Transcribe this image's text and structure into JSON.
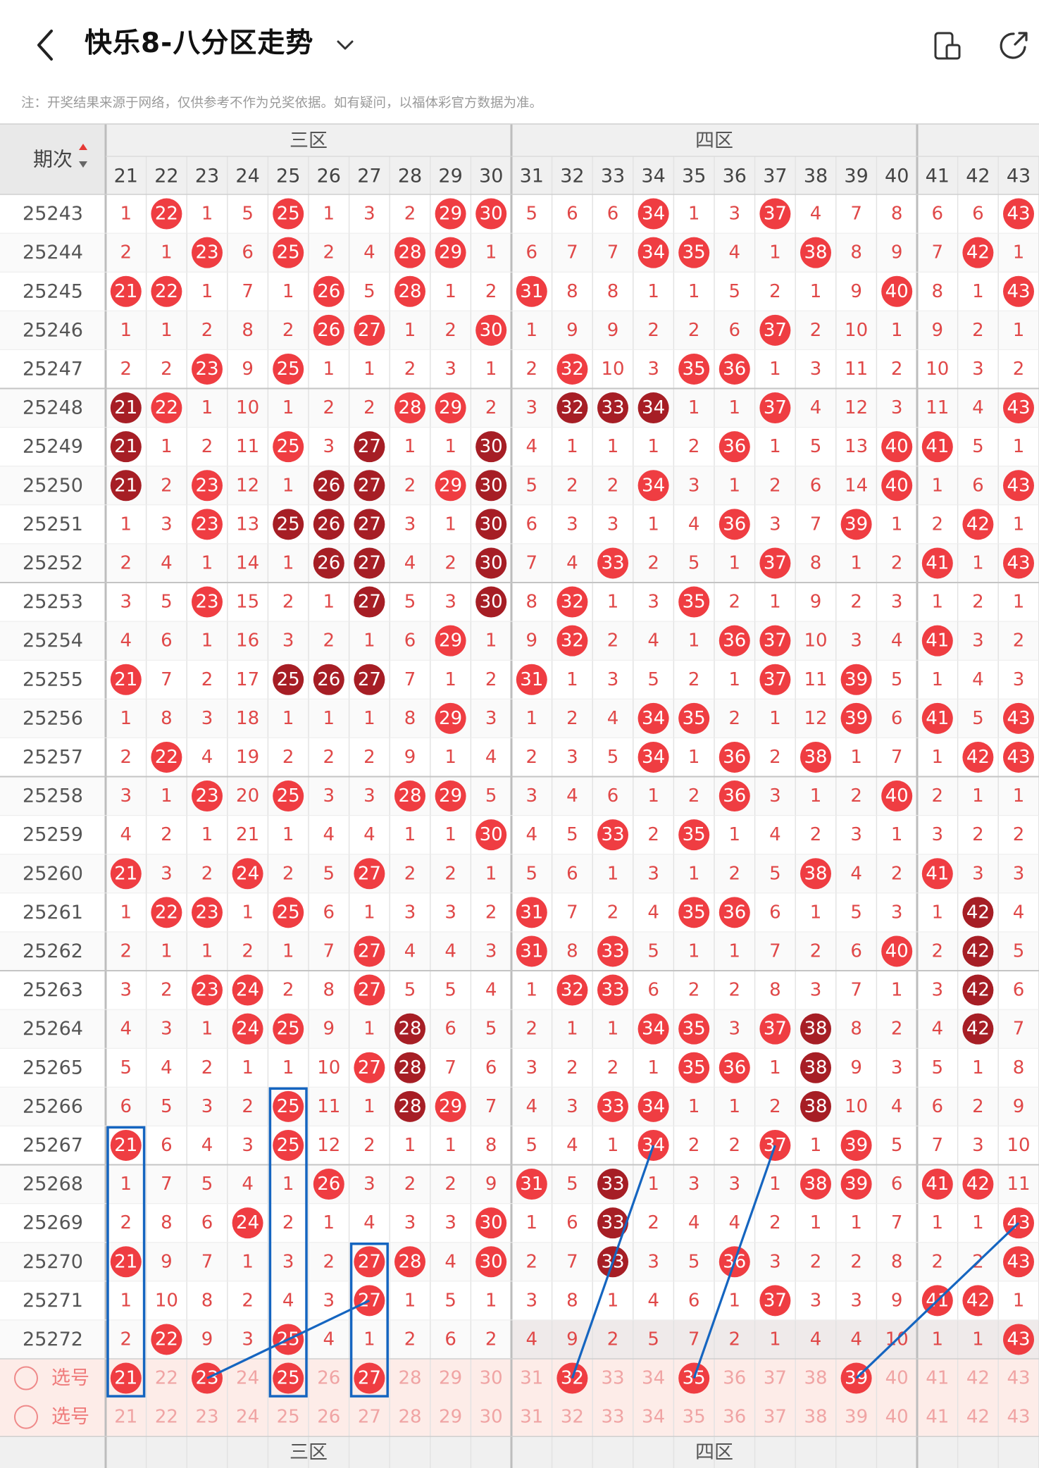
{
  "header": {
    "back_icon": "chevron-left-icon",
    "title": "快乐8-八分区走势",
    "dropdown_icon": "chevron-down-icon",
    "share_icon": "phone-split-icon",
    "refresh_icon": "share-external-icon",
    "note": "注：开奖结果来源于网络，仅供参考不作为兑奖依据。如有疑问，以福体彩官方数据为准。"
  },
  "table": {
    "period_header": "期次",
    "zones": [
      "三区",
      "四区"
    ],
    "columns": [
      21,
      22,
      23,
      24,
      25,
      26,
      27,
      28,
      29,
      30,
      31,
      32,
      33,
      34,
      35,
      36,
      37,
      38,
      39,
      40,
      41,
      42,
      43
    ],
    "rows": [
      {
        "period": "25243",
        "cells": [
          "1",
          "22",
          "1",
          "5",
          "25",
          "1",
          "3",
          "2",
          "29",
          "30",
          "5",
          "6",
          "6",
          "34",
          "1",
          "3",
          "37",
          "4",
          "7",
          "8",
          "6",
          "6",
          "43"
        ]
      },
      {
        "period": "25244",
        "cells": [
          "2",
          "1",
          "23",
          "6",
          "25",
          "2",
          "4",
          "28",
          "29",
          "1",
          "6",
          "7",
          "7",
          "34",
          "35",
          "4",
          "1",
          "38",
          "8",
          "9",
          "7",
          "42",
          "1"
        ]
      },
      {
        "period": "25245",
        "cells": [
          "21",
          "22",
          "1",
          "7",
          "1",
          "26",
          "5",
          "28",
          "1",
          "2",
          "31",
          "8",
          "8",
          "1",
          "1",
          "5",
          "2",
          "1",
          "9",
          "40",
          "8",
          "1",
          "43"
        ]
      },
      {
        "period": "25246",
        "cells": [
          "1",
          "1",
          "2",
          "8",
          "2",
          "26",
          "27",
          "1",
          "2",
          "30",
          "1",
          "9",
          "9",
          "2",
          "2",
          "6",
          "37",
          "2",
          "10",
          "1",
          "9",
          "2",
          "1"
        ]
      },
      {
        "period": "25247",
        "cells": [
          "2",
          "2",
          "23",
          "9",
          "25",
          "1",
          "1",
          "2",
          "3",
          "1",
          "2",
          "32",
          "10",
          "3",
          "35",
          "36",
          "1",
          "3",
          "11",
          "2",
          "10",
          "3",
          "2"
        ]
      },
      {
        "period": "25248",
        "cells": [
          "21",
          "22",
          "1",
          "10",
          "1",
          "2",
          "2",
          "28",
          "29",
          "2",
          "3",
          "32",
          "33",
          "34",
          "1",
          "1",
          "37",
          "4",
          "12",
          "3",
          "11",
          "4",
          "43"
        ]
      },
      {
        "period": "25249",
        "cells": [
          "21",
          "1",
          "2",
          "11",
          "25",
          "3",
          "27",
          "1",
          "1",
          "30",
          "4",
          "1",
          "1",
          "1",
          "2",
          "36",
          "1",
          "5",
          "13",
          "40",
          "41",
          "5",
          "1"
        ]
      },
      {
        "period": "25250",
        "cells": [
          "21",
          "2",
          "23",
          "12",
          "1",
          "26",
          "27",
          "2",
          "29",
          "30",
          "5",
          "2",
          "2",
          "34",
          "3",
          "1",
          "2",
          "6",
          "14",
          "40",
          "1",
          "6",
          "43"
        ]
      },
      {
        "period": "25251",
        "cells": [
          "1",
          "3",
          "23",
          "13",
          "25",
          "26",
          "27",
          "3",
          "1",
          "30",
          "6",
          "3",
          "3",
          "1",
          "4",
          "36",
          "3",
          "7",
          "39",
          "1",
          "2",
          "42",
          "1"
        ]
      },
      {
        "period": "25252",
        "cells": [
          "2",
          "4",
          "1",
          "14",
          "1",
          "26",
          "27",
          "4",
          "2",
          "30",
          "7",
          "4",
          "33",
          "2",
          "5",
          "1",
          "37",
          "8",
          "1",
          "2",
          "41",
          "1",
          "43"
        ]
      },
      {
        "period": "25253",
        "cells": [
          "3",
          "5",
          "23",
          "15",
          "2",
          "1",
          "27",
          "5",
          "3",
          "30",
          "8",
          "32",
          "1",
          "3",
          "35",
          "2",
          "1",
          "9",
          "2",
          "3",
          "1",
          "2",
          "1"
        ]
      },
      {
        "period": "25254",
        "cells": [
          "4",
          "6",
          "1",
          "16",
          "3",
          "2",
          "1",
          "6",
          "29",
          "1",
          "9",
          "32",
          "2",
          "4",
          "1",
          "36",
          "37",
          "10",
          "3",
          "4",
          "41",
          "3",
          "2"
        ]
      },
      {
        "period": "25255",
        "cells": [
          "21",
          "7",
          "2",
          "17",
          "25",
          "26",
          "27",
          "7",
          "1",
          "2",
          "31",
          "1",
          "3",
          "5",
          "2",
          "1",
          "37",
          "11",
          "39",
          "5",
          "1",
          "4",
          "3"
        ]
      },
      {
        "period": "25256",
        "cells": [
          "1",
          "8",
          "3",
          "18",
          "1",
          "1",
          "1",
          "8",
          "29",
          "3",
          "1",
          "2",
          "4",
          "34",
          "35",
          "2",
          "1",
          "12",
          "39",
          "6",
          "41",
          "5",
          "43"
        ]
      },
      {
        "period": "25257",
        "cells": [
          "2",
          "22",
          "4",
          "19",
          "2",
          "2",
          "2",
          "9",
          "1",
          "4",
          "2",
          "3",
          "5",
          "34",
          "1",
          "36",
          "2",
          "38",
          "1",
          "7",
          "1",
          "42",
          "43"
        ]
      },
      {
        "period": "25258",
        "cells": [
          "3",
          "1",
          "23",
          "20",
          "25",
          "3",
          "3",
          "28",
          "29",
          "5",
          "3",
          "4",
          "6",
          "1",
          "2",
          "36",
          "3",
          "1",
          "2",
          "40",
          "2",
          "1",
          "1"
        ]
      },
      {
        "period": "25259",
        "cells": [
          "4",
          "2",
          "1",
          "21",
          "1",
          "4",
          "4",
          "1",
          "1",
          "30",
          "4",
          "5",
          "33",
          "2",
          "35",
          "1",
          "4",
          "2",
          "3",
          "1",
          "3",
          "2",
          "2"
        ]
      },
      {
        "period": "25260",
        "cells": [
          "21",
          "3",
          "2",
          "24",
          "2",
          "5",
          "27",
          "2",
          "2",
          "1",
          "5",
          "6",
          "1",
          "3",
          "1",
          "2",
          "5",
          "38",
          "4",
          "2",
          "41",
          "3",
          "3"
        ]
      },
      {
        "period": "25261",
        "cells": [
          "1",
          "22",
          "23",
          "1",
          "25",
          "6",
          "1",
          "3",
          "3",
          "2",
          "31",
          "7",
          "2",
          "4",
          "35",
          "36",
          "6",
          "1",
          "5",
          "3",
          "1",
          "42",
          "4"
        ]
      },
      {
        "period": "25262",
        "cells": [
          "2",
          "1",
          "1",
          "2",
          "1",
          "7",
          "27",
          "4",
          "4",
          "3",
          "31",
          "8",
          "33",
          "5",
          "1",
          "1",
          "7",
          "2",
          "6",
          "40",
          "2",
          "42",
          "5"
        ]
      },
      {
        "period": "25263",
        "cells": [
          "3",
          "2",
          "23",
          "24",
          "2",
          "8",
          "27",
          "5",
          "5",
          "4",
          "1",
          "32",
          "33",
          "6",
          "2",
          "2",
          "8",
          "3",
          "7",
          "1",
          "3",
          "42",
          "6"
        ]
      },
      {
        "period": "25264",
        "cells": [
          "4",
          "3",
          "1",
          "24",
          "25",
          "9",
          "1",
          "28",
          "6",
          "5",
          "2",
          "1",
          "1",
          "34",
          "35",
          "3",
          "37",
          "38",
          "8",
          "2",
          "4",
          "42",
          "7"
        ]
      },
      {
        "period": "25265",
        "cells": [
          "5",
          "4",
          "2",
          "1",
          "1",
          "10",
          "27",
          "28",
          "7",
          "6",
          "3",
          "2",
          "2",
          "1",
          "35",
          "36",
          "1",
          "38",
          "9",
          "3",
          "5",
          "1",
          "8"
        ]
      },
      {
        "period": "25266",
        "cells": [
          "6",
          "5",
          "3",
          "2",
          "25",
          "11",
          "1",
          "28",
          "29",
          "7",
          "4",
          "3",
          "33",
          "34",
          "1",
          "1",
          "2",
          "38",
          "10",
          "4",
          "6",
          "2",
          "9"
        ]
      },
      {
        "period": "25267",
        "cells": [
          "21",
          "6",
          "4",
          "3",
          "25",
          "12",
          "2",
          "1",
          "1",
          "8",
          "5",
          "4",
          "1",
          "34",
          "2",
          "2",
          "37",
          "1",
          "39",
          "5",
          "7",
          "3",
          "10"
        ]
      },
      {
        "period": "25268",
        "cells": [
          "1",
          "7",
          "5",
          "4",
          "1",
          "26",
          "3",
          "2",
          "2",
          "9",
          "31",
          "5",
          "33",
          "1",
          "3",
          "3",
          "1",
          "38",
          "39",
          "6",
          "41",
          "42",
          "11"
        ]
      },
      {
        "period": "25269",
        "cells": [
          "2",
          "8",
          "6",
          "24",
          "2",
          "1",
          "4",
          "3",
          "3",
          "30",
          "1",
          "6",
          "33",
          "2",
          "4",
          "4",
          "2",
          "1",
          "1",
          "7",
          "1",
          "1",
          "43"
        ]
      },
      {
        "period": "25270",
        "cells": [
          "21",
          "9",
          "7",
          "1",
          "3",
          "2",
          "27",
          "28",
          "4",
          "30",
          "2",
          "7",
          "33",
          "3",
          "5",
          "36",
          "3",
          "2",
          "2",
          "8",
          "2",
          "2",
          "43"
        ]
      },
      {
        "period": "25271",
        "cells": [
          "1",
          "10",
          "8",
          "2",
          "4",
          "3",
          "27",
          "1",
          "5",
          "1",
          "3",
          "8",
          "1",
          "4",
          "6",
          "1",
          "37",
          "3",
          "3",
          "9",
          "41",
          "42",
          "1"
        ]
      },
      {
        "period": "25272",
        "cells": [
          "2",
          "22",
          "9",
          "3",
          "25",
          "4",
          "1",
          "2",
          "6",
          "2",
          "4",
          "9",
          "2",
          "5",
          "7",
          "2",
          "1",
          "4",
          "4",
          "10",
          "1",
          "1",
          "43"
        ]
      }
    ],
    "dark_hits": [
      [
        5,
        0
      ],
      [
        6,
        0
      ],
      [
        7,
        0
      ],
      [
        8,
        4
      ],
      [
        8,
        5
      ],
      [
        8,
        6
      ],
      [
        7,
        5
      ],
      [
        7,
        6
      ],
      [
        6,
        6
      ],
      [
        9,
        5
      ],
      [
        9,
        6
      ],
      [
        10,
        6
      ],
      [
        12,
        4
      ],
      [
        12,
        5
      ],
      [
        12,
        6
      ],
      [
        6,
        9
      ],
      [
        7,
        9
      ],
      [
        8,
        9
      ],
      [
        9,
        9
      ],
      [
        10,
        9
      ],
      [
        5,
        11
      ],
      [
        5,
        12
      ],
      [
        5,
        13
      ],
      [
        21,
        7
      ],
      [
        22,
        7
      ],
      [
        23,
        7
      ],
      [
        21,
        17
      ],
      [
        22,
        17
      ],
      [
        23,
        17
      ],
      [
        25,
        12
      ],
      [
        26,
        12
      ],
      [
        27,
        12
      ],
      [
        18,
        21
      ],
      [
        19,
        21
      ],
      [
        20,
        21
      ],
      [
        21,
        21
      ]
    ],
    "select_label": "选号",
    "select_row_1": {
      "label": "选号",
      "picked": [
        21,
        23,
        25,
        27,
        32,
        35,
        39
      ]
    },
    "select_row_2": {
      "label": "选号",
      "picked": []
    }
  },
  "colors": {
    "hit_red": "#ef3d42",
    "hit_dark": "#a61e25",
    "miss_text": "#e04848",
    "select_bg": "#fdece8",
    "line_blue": "#1565c0",
    "header_bg": "#f0f0f0"
  }
}
